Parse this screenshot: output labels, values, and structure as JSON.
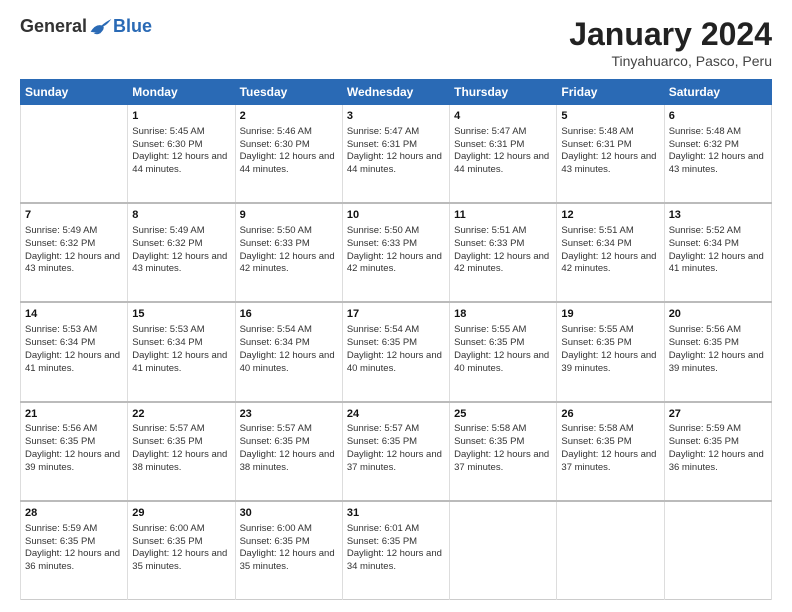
{
  "logo": {
    "general": "General",
    "blue": "Blue"
  },
  "title": "January 2024",
  "location": "Tinyahuarco, Pasco, Peru",
  "days_of_week": [
    "Sunday",
    "Monday",
    "Tuesday",
    "Wednesday",
    "Thursday",
    "Friday",
    "Saturday"
  ],
  "weeks": [
    [
      {
        "day": "",
        "sunrise": "",
        "sunset": "",
        "daylight": ""
      },
      {
        "day": "1",
        "sunrise": "Sunrise: 5:45 AM",
        "sunset": "Sunset: 6:30 PM",
        "daylight": "Daylight: 12 hours and 44 minutes."
      },
      {
        "day": "2",
        "sunrise": "Sunrise: 5:46 AM",
        "sunset": "Sunset: 6:30 PM",
        "daylight": "Daylight: 12 hours and 44 minutes."
      },
      {
        "day": "3",
        "sunrise": "Sunrise: 5:47 AM",
        "sunset": "Sunset: 6:31 PM",
        "daylight": "Daylight: 12 hours and 44 minutes."
      },
      {
        "day": "4",
        "sunrise": "Sunrise: 5:47 AM",
        "sunset": "Sunset: 6:31 PM",
        "daylight": "Daylight: 12 hours and 44 minutes."
      },
      {
        "day": "5",
        "sunrise": "Sunrise: 5:48 AM",
        "sunset": "Sunset: 6:31 PM",
        "daylight": "Daylight: 12 hours and 43 minutes."
      },
      {
        "day": "6",
        "sunrise": "Sunrise: 5:48 AM",
        "sunset": "Sunset: 6:32 PM",
        "daylight": "Daylight: 12 hours and 43 minutes."
      }
    ],
    [
      {
        "day": "7",
        "sunrise": "Sunrise: 5:49 AM",
        "sunset": "Sunset: 6:32 PM",
        "daylight": "Daylight: 12 hours and 43 minutes."
      },
      {
        "day": "8",
        "sunrise": "Sunrise: 5:49 AM",
        "sunset": "Sunset: 6:32 PM",
        "daylight": "Daylight: 12 hours and 43 minutes."
      },
      {
        "day": "9",
        "sunrise": "Sunrise: 5:50 AM",
        "sunset": "Sunset: 6:33 PM",
        "daylight": "Daylight: 12 hours and 42 minutes."
      },
      {
        "day": "10",
        "sunrise": "Sunrise: 5:50 AM",
        "sunset": "Sunset: 6:33 PM",
        "daylight": "Daylight: 12 hours and 42 minutes."
      },
      {
        "day": "11",
        "sunrise": "Sunrise: 5:51 AM",
        "sunset": "Sunset: 6:33 PM",
        "daylight": "Daylight: 12 hours and 42 minutes."
      },
      {
        "day": "12",
        "sunrise": "Sunrise: 5:51 AM",
        "sunset": "Sunset: 6:34 PM",
        "daylight": "Daylight: 12 hours and 42 minutes."
      },
      {
        "day": "13",
        "sunrise": "Sunrise: 5:52 AM",
        "sunset": "Sunset: 6:34 PM",
        "daylight": "Daylight: 12 hours and 41 minutes."
      }
    ],
    [
      {
        "day": "14",
        "sunrise": "Sunrise: 5:53 AM",
        "sunset": "Sunset: 6:34 PM",
        "daylight": "Daylight: 12 hours and 41 minutes."
      },
      {
        "day": "15",
        "sunrise": "Sunrise: 5:53 AM",
        "sunset": "Sunset: 6:34 PM",
        "daylight": "Daylight: 12 hours and 41 minutes."
      },
      {
        "day": "16",
        "sunrise": "Sunrise: 5:54 AM",
        "sunset": "Sunset: 6:34 PM",
        "daylight": "Daylight: 12 hours and 40 minutes."
      },
      {
        "day": "17",
        "sunrise": "Sunrise: 5:54 AM",
        "sunset": "Sunset: 6:35 PM",
        "daylight": "Daylight: 12 hours and 40 minutes."
      },
      {
        "day": "18",
        "sunrise": "Sunrise: 5:55 AM",
        "sunset": "Sunset: 6:35 PM",
        "daylight": "Daylight: 12 hours and 40 minutes."
      },
      {
        "day": "19",
        "sunrise": "Sunrise: 5:55 AM",
        "sunset": "Sunset: 6:35 PM",
        "daylight": "Daylight: 12 hours and 39 minutes."
      },
      {
        "day": "20",
        "sunrise": "Sunrise: 5:56 AM",
        "sunset": "Sunset: 6:35 PM",
        "daylight": "Daylight: 12 hours and 39 minutes."
      }
    ],
    [
      {
        "day": "21",
        "sunrise": "Sunrise: 5:56 AM",
        "sunset": "Sunset: 6:35 PM",
        "daylight": "Daylight: 12 hours and 39 minutes."
      },
      {
        "day": "22",
        "sunrise": "Sunrise: 5:57 AM",
        "sunset": "Sunset: 6:35 PM",
        "daylight": "Daylight: 12 hours and 38 minutes."
      },
      {
        "day": "23",
        "sunrise": "Sunrise: 5:57 AM",
        "sunset": "Sunset: 6:35 PM",
        "daylight": "Daylight: 12 hours and 38 minutes."
      },
      {
        "day": "24",
        "sunrise": "Sunrise: 5:57 AM",
        "sunset": "Sunset: 6:35 PM",
        "daylight": "Daylight: 12 hours and 37 minutes."
      },
      {
        "day": "25",
        "sunrise": "Sunrise: 5:58 AM",
        "sunset": "Sunset: 6:35 PM",
        "daylight": "Daylight: 12 hours and 37 minutes."
      },
      {
        "day": "26",
        "sunrise": "Sunrise: 5:58 AM",
        "sunset": "Sunset: 6:35 PM",
        "daylight": "Daylight: 12 hours and 37 minutes."
      },
      {
        "day": "27",
        "sunrise": "Sunrise: 5:59 AM",
        "sunset": "Sunset: 6:35 PM",
        "daylight": "Daylight: 12 hours and 36 minutes."
      }
    ],
    [
      {
        "day": "28",
        "sunrise": "Sunrise: 5:59 AM",
        "sunset": "Sunset: 6:35 PM",
        "daylight": "Daylight: 12 hours and 36 minutes."
      },
      {
        "day": "29",
        "sunrise": "Sunrise: 6:00 AM",
        "sunset": "Sunset: 6:35 PM",
        "daylight": "Daylight: 12 hours and 35 minutes."
      },
      {
        "day": "30",
        "sunrise": "Sunrise: 6:00 AM",
        "sunset": "Sunset: 6:35 PM",
        "daylight": "Daylight: 12 hours and 35 minutes."
      },
      {
        "day": "31",
        "sunrise": "Sunrise: 6:01 AM",
        "sunset": "Sunset: 6:35 PM",
        "daylight": "Daylight: 12 hours and 34 minutes."
      },
      {
        "day": "",
        "sunrise": "",
        "sunset": "",
        "daylight": ""
      },
      {
        "day": "",
        "sunrise": "",
        "sunset": "",
        "daylight": ""
      },
      {
        "day": "",
        "sunrise": "",
        "sunset": "",
        "daylight": ""
      }
    ]
  ]
}
